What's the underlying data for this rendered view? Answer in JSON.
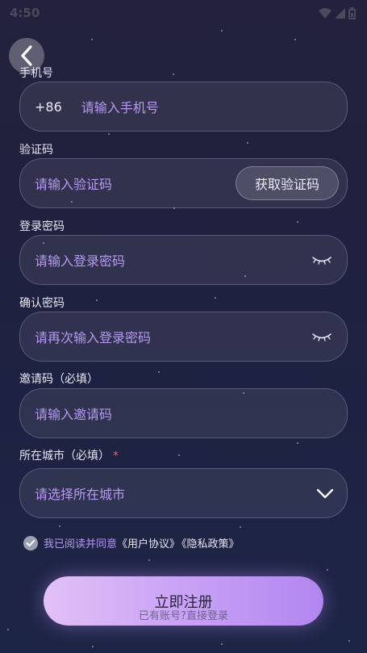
{
  "status_bar": {
    "time": "4:50"
  },
  "form": {
    "phone": {
      "label": "手机号",
      "prefix": "+86",
      "placeholder": "请输入手机号"
    },
    "code": {
      "label": "验证码",
      "placeholder": "请输入验证码",
      "button": "获取验证码"
    },
    "password": {
      "label": "登录密码",
      "placeholder": "请输入登录密码"
    },
    "confirm": {
      "label": "确认密码",
      "placeholder": "请再次输入登录密码"
    },
    "invite": {
      "label": "邀请码（必填）",
      "placeholder": "请输入邀请码"
    },
    "city": {
      "label": "所在城市（必填）",
      "required_mark": "*",
      "placeholder": "请选择所在城市"
    }
  },
  "agreement": {
    "text": "我已阅读并同意",
    "user_agreement": "《用户协议》",
    "privacy_policy": "《隐私政策》"
  },
  "submit_label": "立即注册",
  "login_hint": "已有账号?直接登录",
  "icons": [
    "back-icon",
    "wifi-icon",
    "signal-icon",
    "battery-icon",
    "eye-closed-icon",
    "chevron-down-icon",
    "check-icon"
  ],
  "colors": {
    "accent": "#b79af0",
    "required": "#f05a6a",
    "button_start": "#e2c1f7",
    "button_end": "#b286f0"
  }
}
